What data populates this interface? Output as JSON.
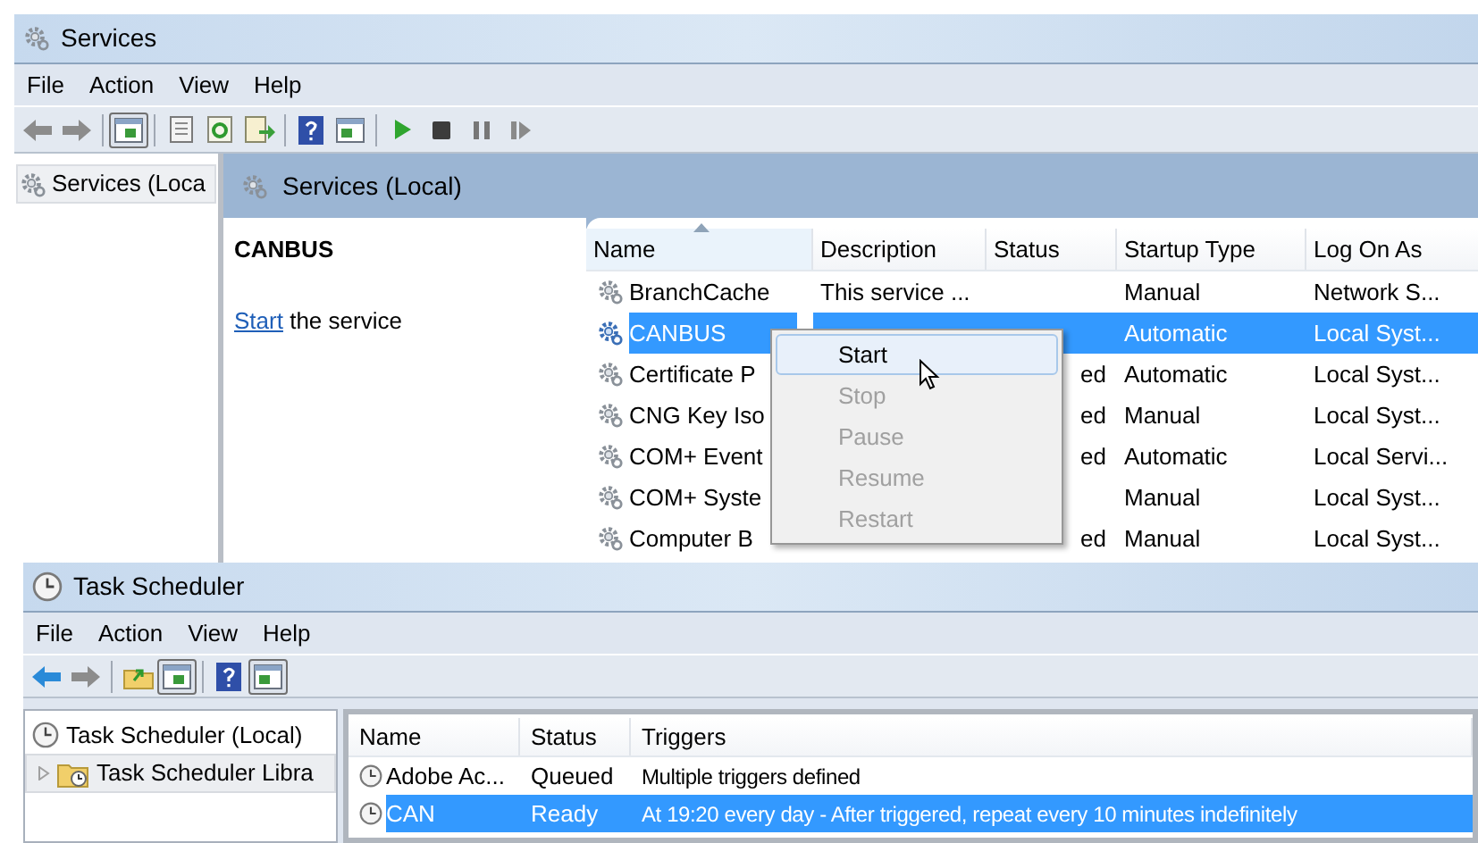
{
  "services_window": {
    "title": "Services",
    "menu": [
      "File",
      "Action",
      "View",
      "Help"
    ],
    "tree_item": {
      "label": "Services (Loca",
      "selected": true
    },
    "pane_header": "Services (Local)",
    "detail": {
      "title": "CANBUS",
      "link": "Start",
      "text": "the service"
    },
    "columns": [
      {
        "label": "Name",
        "sorted": true
      },
      {
        "label": "Description",
        "sorted": false
      },
      {
        "label": "Status",
        "sorted": false
      },
      {
        "label": "Startup Type",
        "sorted": false
      },
      {
        "label": "Log On As",
        "sorted": false
      }
    ],
    "rows": [
      {
        "selected": false,
        "cells": [
          "BranchCache",
          "This service ...",
          "",
          "Manual",
          "Network S..."
        ]
      },
      {
        "selected": true,
        "cells": [
          "CANBUS",
          "",
          "",
          "Automatic",
          "Local Syst..."
        ]
      },
      {
        "selected": false,
        "cells": [
          "Certificate P",
          "",
          "ed",
          "Automatic",
          "Local Syst..."
        ]
      },
      {
        "selected": false,
        "cells": [
          "CNG Key Iso",
          "",
          "ed",
          "Manual",
          "Local Syst..."
        ]
      },
      {
        "selected": false,
        "cells": [
          "COM+ Event",
          "",
          "ed",
          "Automatic",
          "Local Servi..."
        ]
      },
      {
        "selected": false,
        "cells": [
          "COM+ Syste",
          "",
          "",
          "Manual",
          "Local Syst..."
        ]
      },
      {
        "selected": false,
        "cells": [
          "Computer B",
          "",
          "ed",
          "Manual",
          "Local Syst..."
        ]
      }
    ],
    "context_menu": [
      {
        "label": "Start",
        "disabled": false,
        "highlighted": true
      },
      {
        "label": "Stop",
        "disabled": true,
        "highlighted": false
      },
      {
        "label": "Pause",
        "disabled": true,
        "highlighted": false
      },
      {
        "label": "Resume",
        "disabled": true,
        "highlighted": false
      },
      {
        "label": "Restart",
        "disabled": true,
        "highlighted": false
      }
    ]
  },
  "task_window": {
    "title": "Task Scheduler",
    "menu": [
      "File",
      "Action",
      "View",
      "Help"
    ],
    "tree": [
      {
        "label": "Task Scheduler (Local)",
        "selected": false,
        "children": [
          {
            "label": "Task Scheduler Libra",
            "selected": true,
            "expanded": false
          }
        ]
      }
    ],
    "columns": [
      "Name",
      "Status",
      "Triggers"
    ],
    "rows": [
      {
        "selected": false,
        "cells": [
          "Adobe Ac...",
          "Queued",
          "Multiple triggers defined"
        ]
      },
      {
        "selected": true,
        "cells": [
          "CAN",
          "Ready",
          "At 19:20 every day - After triggered, repeat every 10 minutes indefinitely"
        ]
      }
    ]
  }
}
